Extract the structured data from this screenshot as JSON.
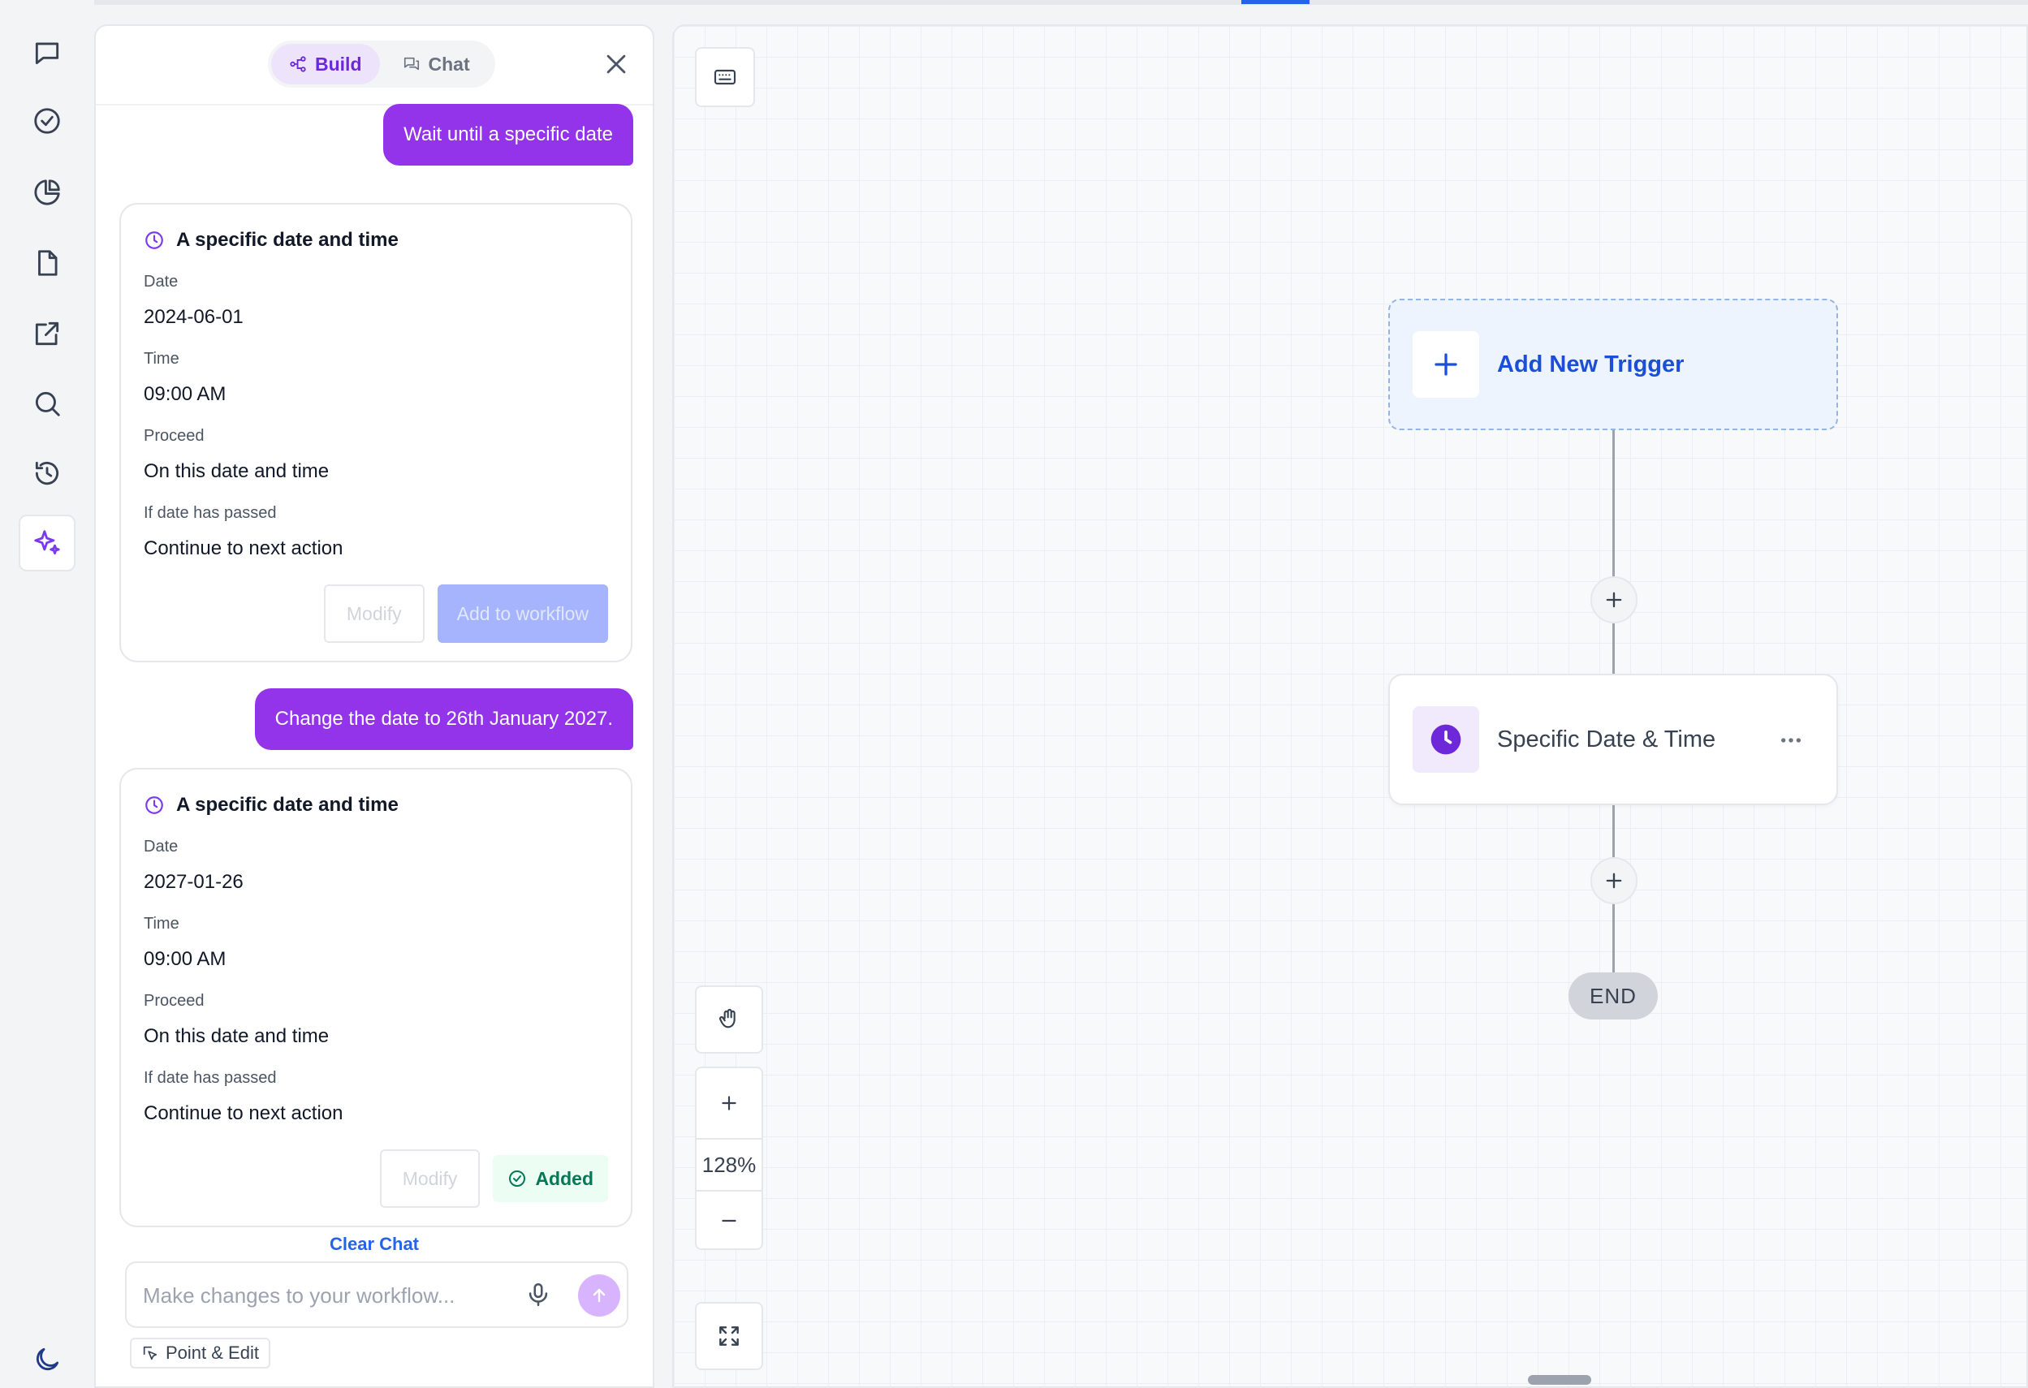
{
  "assistant": {
    "tabs": [
      {
        "label": "Build",
        "active": true
      },
      {
        "label": "Chat",
        "active": false
      }
    ],
    "messages": [
      {
        "role": "user",
        "text": "Wait until a specific date"
      },
      {
        "role": "assistant",
        "title": "A specific date and time",
        "fields": [
          {
            "label": "Date",
            "value": "2024-06-01"
          },
          {
            "label": "Time",
            "value": "09:00 AM"
          },
          {
            "label": "Proceed",
            "value": "On this date and time"
          },
          {
            "label": "If date has passed",
            "value": "Continue to next action"
          }
        ],
        "modify_label": "Modify",
        "add_label": "Add to workflow"
      },
      {
        "role": "user",
        "text": "Change the date to 26th January 2027."
      },
      {
        "role": "assistant",
        "title": "A specific date and time",
        "fields": [
          {
            "label": "Date",
            "value": "2027-01-26"
          },
          {
            "label": "Time",
            "value": "09:00 AM"
          },
          {
            "label": "Proceed",
            "value": "On this date and time"
          },
          {
            "label": "If date has passed",
            "value": "Continue to next action"
          }
        ],
        "modify_label": "Modify",
        "added_label": "Added"
      }
    ],
    "clear_chat": "Clear Chat",
    "composer": {
      "placeholder": "Make changes to your workflow...",
      "value": ""
    },
    "point_edit": "Point & Edit"
  },
  "canvas": {
    "zoom": "128%",
    "trigger_label": "Add New Trigger",
    "action_label": "Specific Date & Time",
    "end_label": "END"
  },
  "colors": {
    "accent_purple": "#9333ea",
    "trigger_blue": "#1d4ed8",
    "added_green": "#047857"
  },
  "rail_icons": [
    "chat-bubble-icon",
    "check-circle-icon",
    "pie-chart-icon",
    "document-icon",
    "external-link-icon",
    "search-icon",
    "history-icon",
    "sparkles-icon",
    "moon-icon"
  ]
}
